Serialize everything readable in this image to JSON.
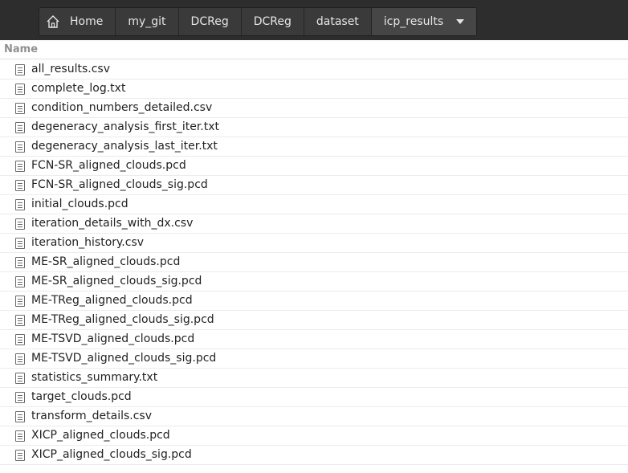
{
  "breadcrumb": [
    {
      "label": "Home",
      "icon": "home-icon"
    },
    {
      "label": "my_git"
    },
    {
      "label": "DCReg"
    },
    {
      "label": "DCReg"
    },
    {
      "label": "dataset"
    },
    {
      "label": "icp_results",
      "active": true,
      "icon": "chevron-down-icon"
    }
  ],
  "column_header": "Name",
  "files": [
    "all_results.csv",
    "complete_log.txt",
    "condition_numbers_detailed.csv",
    "degeneracy_analysis_first_iter.txt",
    "degeneracy_analysis_last_iter.txt",
    "FCN-SR_aligned_clouds.pcd",
    "FCN-SR_aligned_clouds_sig.pcd",
    "initial_clouds.pcd",
    "iteration_details_with_dx.csv",
    "iteration_history.csv",
    "ME-SR_aligned_clouds.pcd",
    "ME-SR_aligned_clouds_sig.pcd",
    "ME-TReg_aligned_clouds.pcd",
    "ME-TReg_aligned_clouds_sig.pcd",
    "ME-TSVD_aligned_clouds.pcd",
    "ME-TSVD_aligned_clouds_sig.pcd",
    "statistics_summary.txt",
    "target_clouds.pcd",
    "transform_details.csv",
    "XICP_aligned_clouds.pcd",
    "XICP_aligned_clouds_sig.pcd"
  ]
}
